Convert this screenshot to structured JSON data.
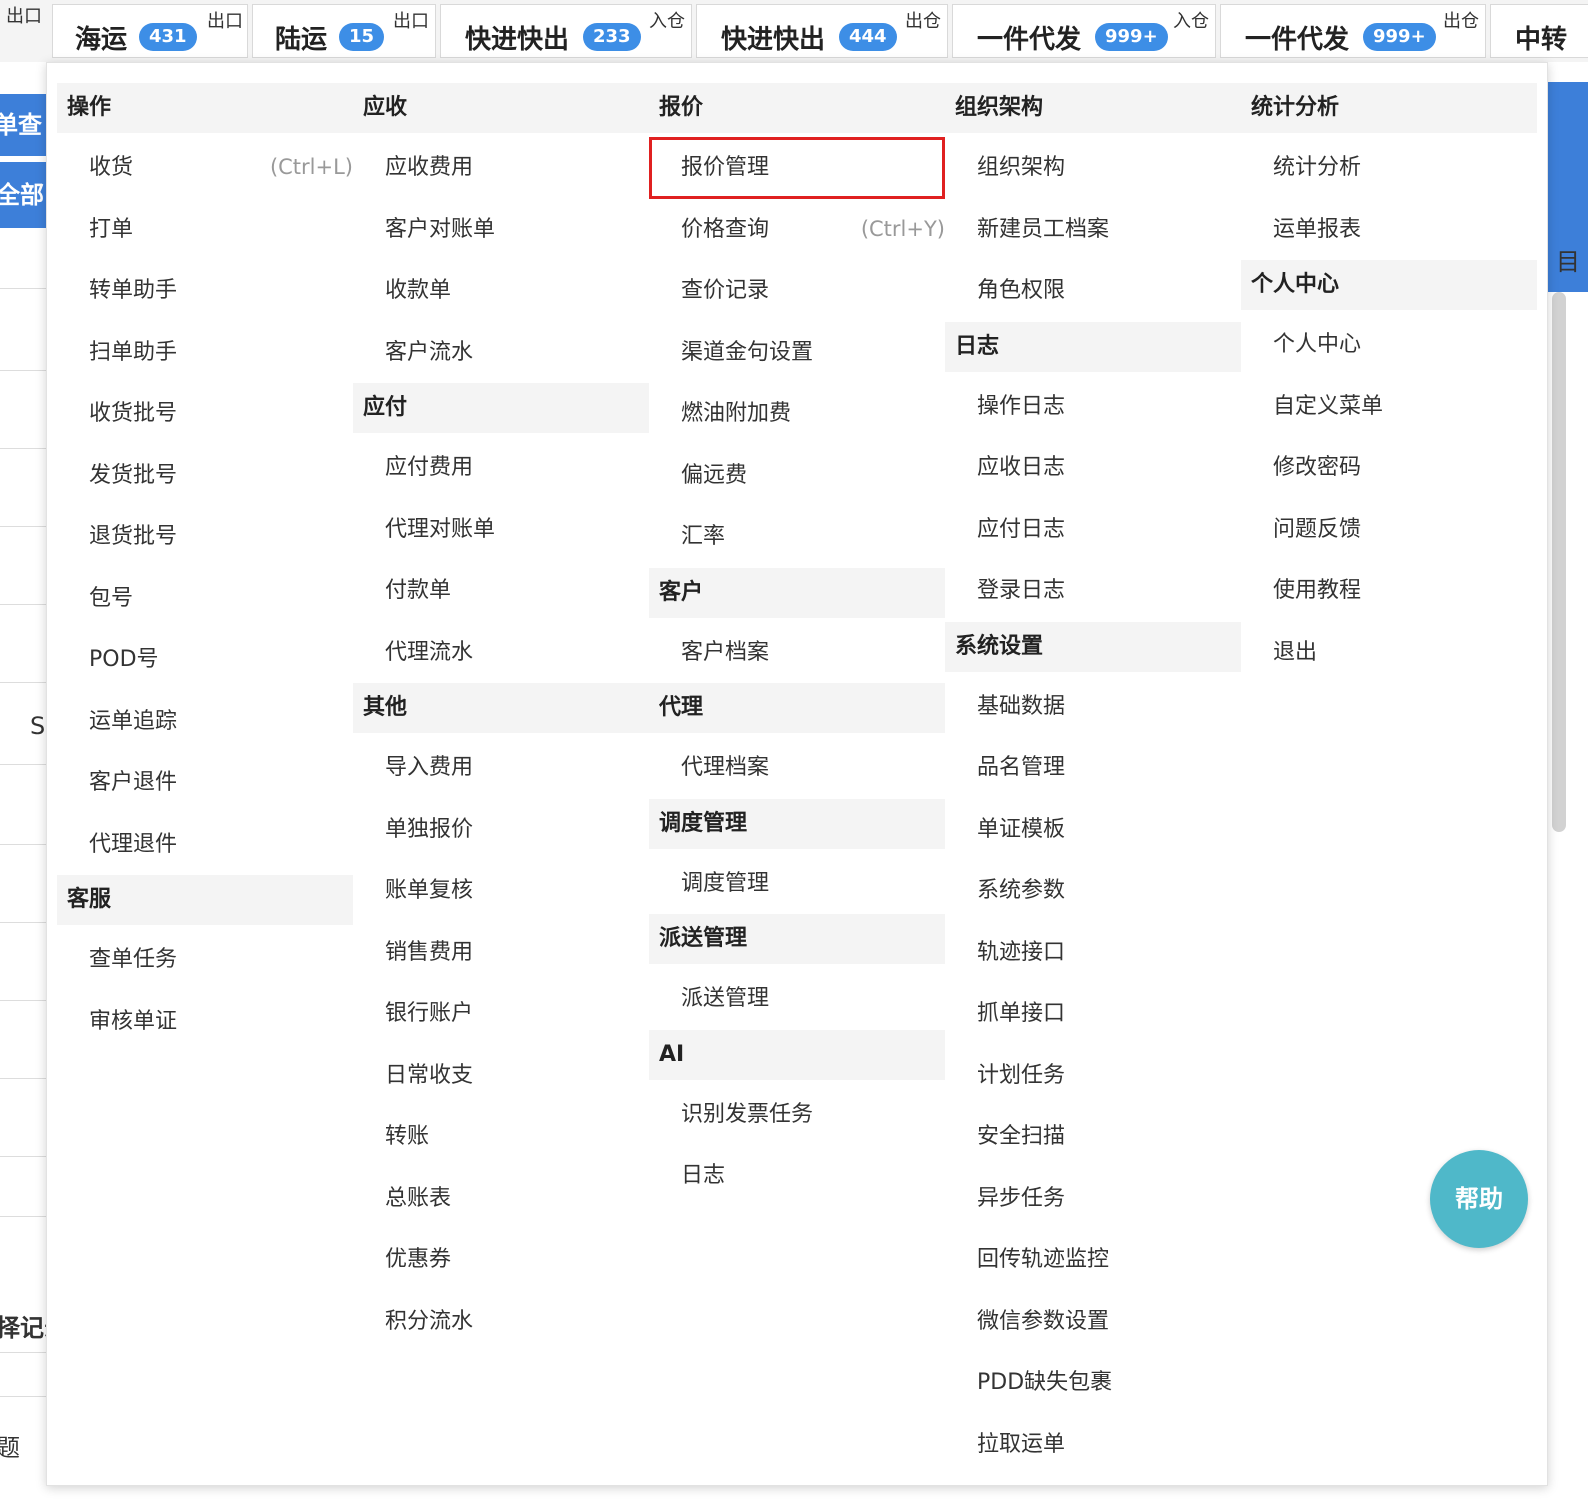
{
  "tabs": [
    {
      "corner_left": "出口",
      "label": "海运",
      "badge": "431"
    },
    {
      "corner_left": "出口",
      "label": "陆运",
      "badge": "15"
    },
    {
      "corner_left": "出口",
      "label": "快进快出",
      "badge": "233"
    },
    {
      "corner_left": "入仓",
      "label": "快进快出",
      "badge": "444"
    },
    {
      "corner_left": "出仓",
      "label": "一件代发",
      "badge": "999+"
    },
    {
      "corner_left": "入仓",
      "label": "一件代发",
      "badge": "999+"
    },
    {
      "corner_left": "出仓",
      "label": "中转",
      "badge": ""
    }
  ],
  "background": {
    "left_fragments": [
      "单查",
      "全部",
      "S",
      "择记录",
      "题"
    ],
    "right_fragment": "目"
  },
  "menu": {
    "columns": [
      {
        "groups": [
          {
            "title": "操作",
            "items": [
              {
                "label": "收货",
                "shortcut": "(Ctrl+L)"
              },
              {
                "label": "打单"
              },
              {
                "label": "转单助手"
              },
              {
                "label": "扫单助手"
              },
              {
                "label": "收货批号"
              },
              {
                "label": "发货批号"
              },
              {
                "label": "退货批号"
              },
              {
                "label": "包号"
              },
              {
                "label": "POD号"
              },
              {
                "label": "运单追踪"
              },
              {
                "label": "客户退件"
              },
              {
                "label": "代理退件"
              }
            ]
          },
          {
            "title": "客服",
            "items": [
              {
                "label": "查单任务"
              },
              {
                "label": "审核单证"
              }
            ]
          }
        ]
      },
      {
        "groups": [
          {
            "title": "应收",
            "items": [
              {
                "label": "应收费用"
              },
              {
                "label": "客户对账单"
              },
              {
                "label": "收款单"
              },
              {
                "label": "客户流水"
              }
            ]
          },
          {
            "title": "应付",
            "items": [
              {
                "label": "应付费用"
              },
              {
                "label": "代理对账单"
              },
              {
                "label": "付款单"
              },
              {
                "label": "代理流水"
              }
            ]
          },
          {
            "title": "其他",
            "items": [
              {
                "label": "导入费用"
              },
              {
                "label": "单独报价"
              },
              {
                "label": "账单复核"
              },
              {
                "label": "销售费用"
              },
              {
                "label": "银行账户"
              },
              {
                "label": "日常收支"
              },
              {
                "label": "转账"
              },
              {
                "label": "总账表"
              },
              {
                "label": "优惠券"
              },
              {
                "label": "积分流水"
              }
            ]
          }
        ]
      },
      {
        "groups": [
          {
            "title": "报价",
            "items": [
              {
                "label": "报价管理",
                "highlighted": true
              },
              {
                "label": "价格查询",
                "shortcut": "(Ctrl+Y)"
              },
              {
                "label": "查价记录"
              },
              {
                "label": "渠道金句设置"
              },
              {
                "label": "燃油附加费"
              },
              {
                "label": "偏远费"
              },
              {
                "label": "汇率"
              }
            ]
          },
          {
            "title": "客户",
            "items": [
              {
                "label": "客户档案"
              }
            ]
          },
          {
            "title": "代理",
            "items": [
              {
                "label": "代理档案"
              }
            ]
          },
          {
            "title": "调度管理",
            "items": [
              {
                "label": "调度管理"
              }
            ]
          },
          {
            "title": "派送管理",
            "items": [
              {
                "label": "派送管理"
              }
            ]
          },
          {
            "title": "AI",
            "items": [
              {
                "label": "识别发票任务"
              },
              {
                "label": "日志"
              }
            ]
          }
        ]
      },
      {
        "groups": [
          {
            "title": "组织架构",
            "items": [
              {
                "label": "组织架构"
              },
              {
                "label": "新建员工档案"
              },
              {
                "label": "角色权限"
              }
            ]
          },
          {
            "title": "日志",
            "items": [
              {
                "label": "操作日志"
              },
              {
                "label": "应收日志"
              },
              {
                "label": "应付日志"
              },
              {
                "label": "登录日志"
              }
            ]
          },
          {
            "title": "系统设置",
            "items": [
              {
                "label": "基础数据"
              },
              {
                "label": "品名管理"
              },
              {
                "label": "单证模板"
              },
              {
                "label": "系统参数"
              },
              {
                "label": "轨迹接口"
              },
              {
                "label": "抓单接口"
              },
              {
                "label": "计划任务"
              },
              {
                "label": "安全扫描"
              },
              {
                "label": "异步任务"
              },
              {
                "label": "回传轨迹监控"
              },
              {
                "label": "微信参数设置"
              },
              {
                "label": "PDD缺失包裹"
              },
              {
                "label": "拉取运单"
              }
            ]
          }
        ]
      },
      {
        "groups": [
          {
            "title": "统计分析",
            "items": [
              {
                "label": "统计分析"
              },
              {
                "label": "运单报表"
              }
            ]
          },
          {
            "title": "个人中心",
            "items": [
              {
                "label": "个人中心"
              },
              {
                "label": "自定义菜单"
              },
              {
                "label": "修改密码"
              },
              {
                "label": "问题反馈"
              },
              {
                "label": "使用教程"
              },
              {
                "label": "退出"
              }
            ]
          }
        ]
      }
    ]
  },
  "help_button": {
    "label": "帮助"
  },
  "colors": {
    "badge": "#3d8ee6",
    "highlight_border": "#e02020",
    "help_button": "#4fb8c9",
    "group_header_bg": "#f4f4f4",
    "shortcut_text": "#999999"
  }
}
